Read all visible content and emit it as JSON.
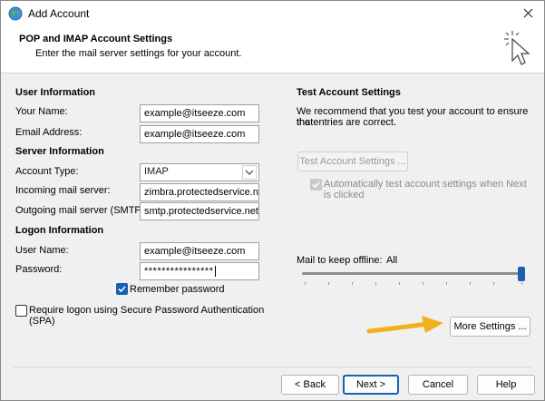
{
  "window": {
    "title": "Add Account",
    "close_icon": "close-icon"
  },
  "header": {
    "title": "POP and IMAP Account Settings",
    "subtitle": "Enter the mail server settings for your account."
  },
  "user_info": {
    "heading": "User Information",
    "name_label": "Your Name:",
    "name_value": "example@itseeze.com",
    "email_label": "Email Address:",
    "email_value": "example@itseeze.com"
  },
  "server_info": {
    "heading": "Server Information",
    "type_label": "Account Type:",
    "type_value": "IMAP",
    "incoming_label": "Incoming mail server:",
    "incoming_value": "zimbra.protectedservice.net",
    "outgoing_label": "Outgoing mail server (SMTP):",
    "outgoing_value": "smtp.protectedservice.net"
  },
  "logon_info": {
    "heading": "Logon Information",
    "user_label": "User Name:",
    "user_value": "example@itseeze.com",
    "password_label": "Password:",
    "password_value": "****************",
    "remember_label": "Remember password",
    "remember_checked": true,
    "spa_label_1": "Require logon using Secure Password Authentication",
    "spa_label_2": "(SPA)",
    "spa_checked": false
  },
  "test": {
    "heading": "Test Account Settings",
    "desc_1": "We recommend that you test your account to ensure that",
    "desc_2": "the entries are correct.",
    "button": "Test Account Settings ...",
    "auto_1": "Automatically test account settings when Next",
    "auto_2": "is clicked",
    "auto_checked": true
  },
  "offline": {
    "label": "Mail to keep offline:",
    "value": "All",
    "level": 1.0
  },
  "more_settings": "More Settings ...",
  "footer": {
    "back": "< Back",
    "next": "Next >",
    "cancel": "Cancel",
    "help": "Help"
  },
  "colors": {
    "accent": "#1a5fb4",
    "arrow": "#f2b01e"
  }
}
